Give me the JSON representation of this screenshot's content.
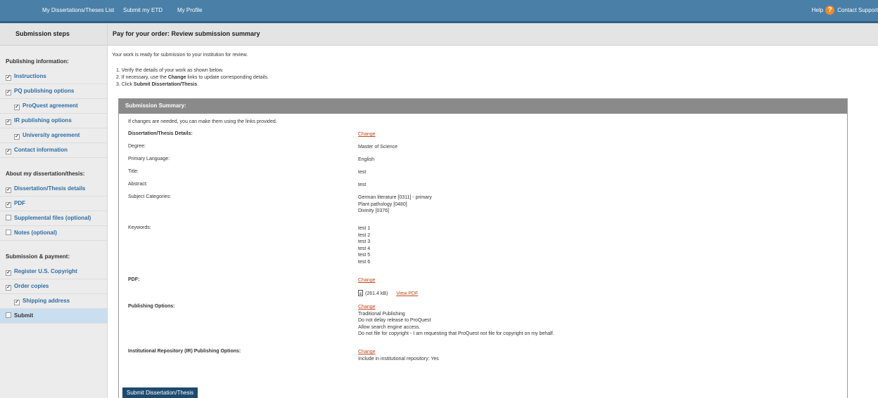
{
  "topnav": {
    "items": [
      "My Dissertations/Theses List",
      "Submit my ETD",
      "My Profile"
    ],
    "help": "Help",
    "help_icon": "?",
    "contact": "Contact Support"
  },
  "sidebar": {
    "title": "Submission steps",
    "groups": [
      {
        "label": "Publishing information:",
        "items": [
          {
            "label": "Instructions",
            "checked": true
          },
          {
            "label": "PQ publishing options",
            "checked": true
          },
          {
            "label": "ProQuest agreement",
            "checked": true
          },
          {
            "label": "IR publishing options",
            "checked": true
          },
          {
            "label": "University agreement",
            "checked": true
          },
          {
            "label": "Contact information",
            "checked": true
          }
        ]
      },
      {
        "label": "About my dissertation/thesis:",
        "items": [
          {
            "label": "Dissertation/Thesis details",
            "checked": true
          },
          {
            "label": "PDF",
            "checked": true
          },
          {
            "label": "Supplemental files (optional)",
            "checked": false
          },
          {
            "label": "Notes (optional)",
            "checked": false
          }
        ]
      },
      {
        "label": "Submission & payment:",
        "items": [
          {
            "label": "Register U.S. Copyright",
            "checked": true
          },
          {
            "label": "Order copies",
            "checked": true
          },
          {
            "label": "Shipping address",
            "checked": true
          },
          {
            "label": "Submit",
            "checked": false
          }
        ]
      }
    ]
  },
  "main": {
    "title": "Pay for your order: Review submission summary",
    "intro": "Your work is ready for submission to your institution for review.",
    "steps": {
      "s1": "1. Verify the details of your work as shown below.",
      "s2_pre": "2. If necessary, use the ",
      "s2_bold": "Change",
      "s2_post": " links to update corresponding details.",
      "s3_pre": "3. Click ",
      "s3_bold": "Submit Dissertation/Thesis",
      "s3_post": "."
    },
    "summary": {
      "header": "Submission Summary:",
      "note": "If changes are needed, you can make them using the links provided.",
      "change_label": "Change",
      "details_label": "Dissertation/Thesis Details:",
      "degree_label": "Degree:",
      "degree": "Master of Science",
      "language_label": "Primary Language:",
      "language": "English",
      "title_label": "Title:",
      "title": "test",
      "abstract_label": "Abstract:",
      "abstract": "test",
      "subjects_label": "Subject Categories:",
      "subjects": [
        "German literature [0311] - primary",
        "Plant pathology [0480]",
        "Divinity [0376]"
      ],
      "keywords_label": "Keywords:",
      "keywords": [
        "test 1",
        "test 2",
        "test 3",
        "test 4",
        "test 5",
        "test 6"
      ],
      "pdf_label": "PDF:",
      "pdf_size": "(261.4 kB)",
      "view_pdf": "View PDF",
      "pub_label": "Publishing Options:",
      "pub_options": [
        "Traditional Publishing",
        "Do not delay release to ProQuest",
        "Allow search engine access.",
        "Do not file for copyright - I am requesting that ProQuest not file for copyright on my behalf."
      ],
      "ir_label": "Institutional Repository (IR) Publishing Options:",
      "ir_option": "Include in institutional repository: Yes"
    },
    "submit_button": "Submit Dissertation/Thesis"
  }
}
